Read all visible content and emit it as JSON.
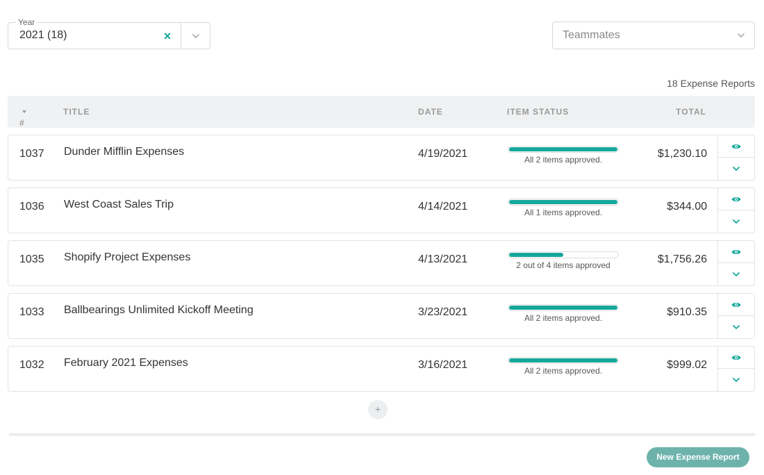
{
  "filters": {
    "year": {
      "label": "Year",
      "value": "2021 (18)",
      "clear_glyph": "×"
    },
    "teammates": {
      "placeholder": "Teammates"
    }
  },
  "report_count": "18 Expense Reports",
  "table": {
    "headers": {
      "number": "#",
      "title": "TITLE",
      "date": "DATE",
      "status": "ITEM STATUS",
      "total": "TOTAL"
    },
    "rows": [
      {
        "number": "1037",
        "title": "Dunder Mifflin Expenses",
        "date": "4/19/2021",
        "status_text": "All 2 items approved.",
        "progress": 1.0,
        "total": "$1,230.10"
      },
      {
        "number": "1036",
        "title": "West Coast Sales Trip",
        "date": "4/14/2021",
        "status_text": "All 1 items approved.",
        "progress": 1.0,
        "total": "$344.00"
      },
      {
        "number": "1035",
        "title": "Shopify Project Expenses",
        "date": "4/13/2021",
        "status_text": "2 out of 4 items approved",
        "progress": 0.5,
        "total": "$1,756.26"
      },
      {
        "number": "1033",
        "title": "Ballbearings Unlimited Kickoff Meeting",
        "date": "3/23/2021",
        "status_text": "All 2 items approved.",
        "progress": 1.0,
        "total": "$910.35"
      },
      {
        "number": "1032",
        "title": "February 2021 Expenses",
        "date": "3/16/2021",
        "status_text": "All 2 items approved.",
        "progress": 1.0,
        "total": "$999.02"
      }
    ]
  },
  "add_more_glyph": "+",
  "new_report_label": "New Expense Report",
  "colors": {
    "accent": "#14a89a",
    "button": "#6db3ac"
  },
  "icons": {
    "view": "eye-icon",
    "expand": "chevron-down-icon"
  }
}
